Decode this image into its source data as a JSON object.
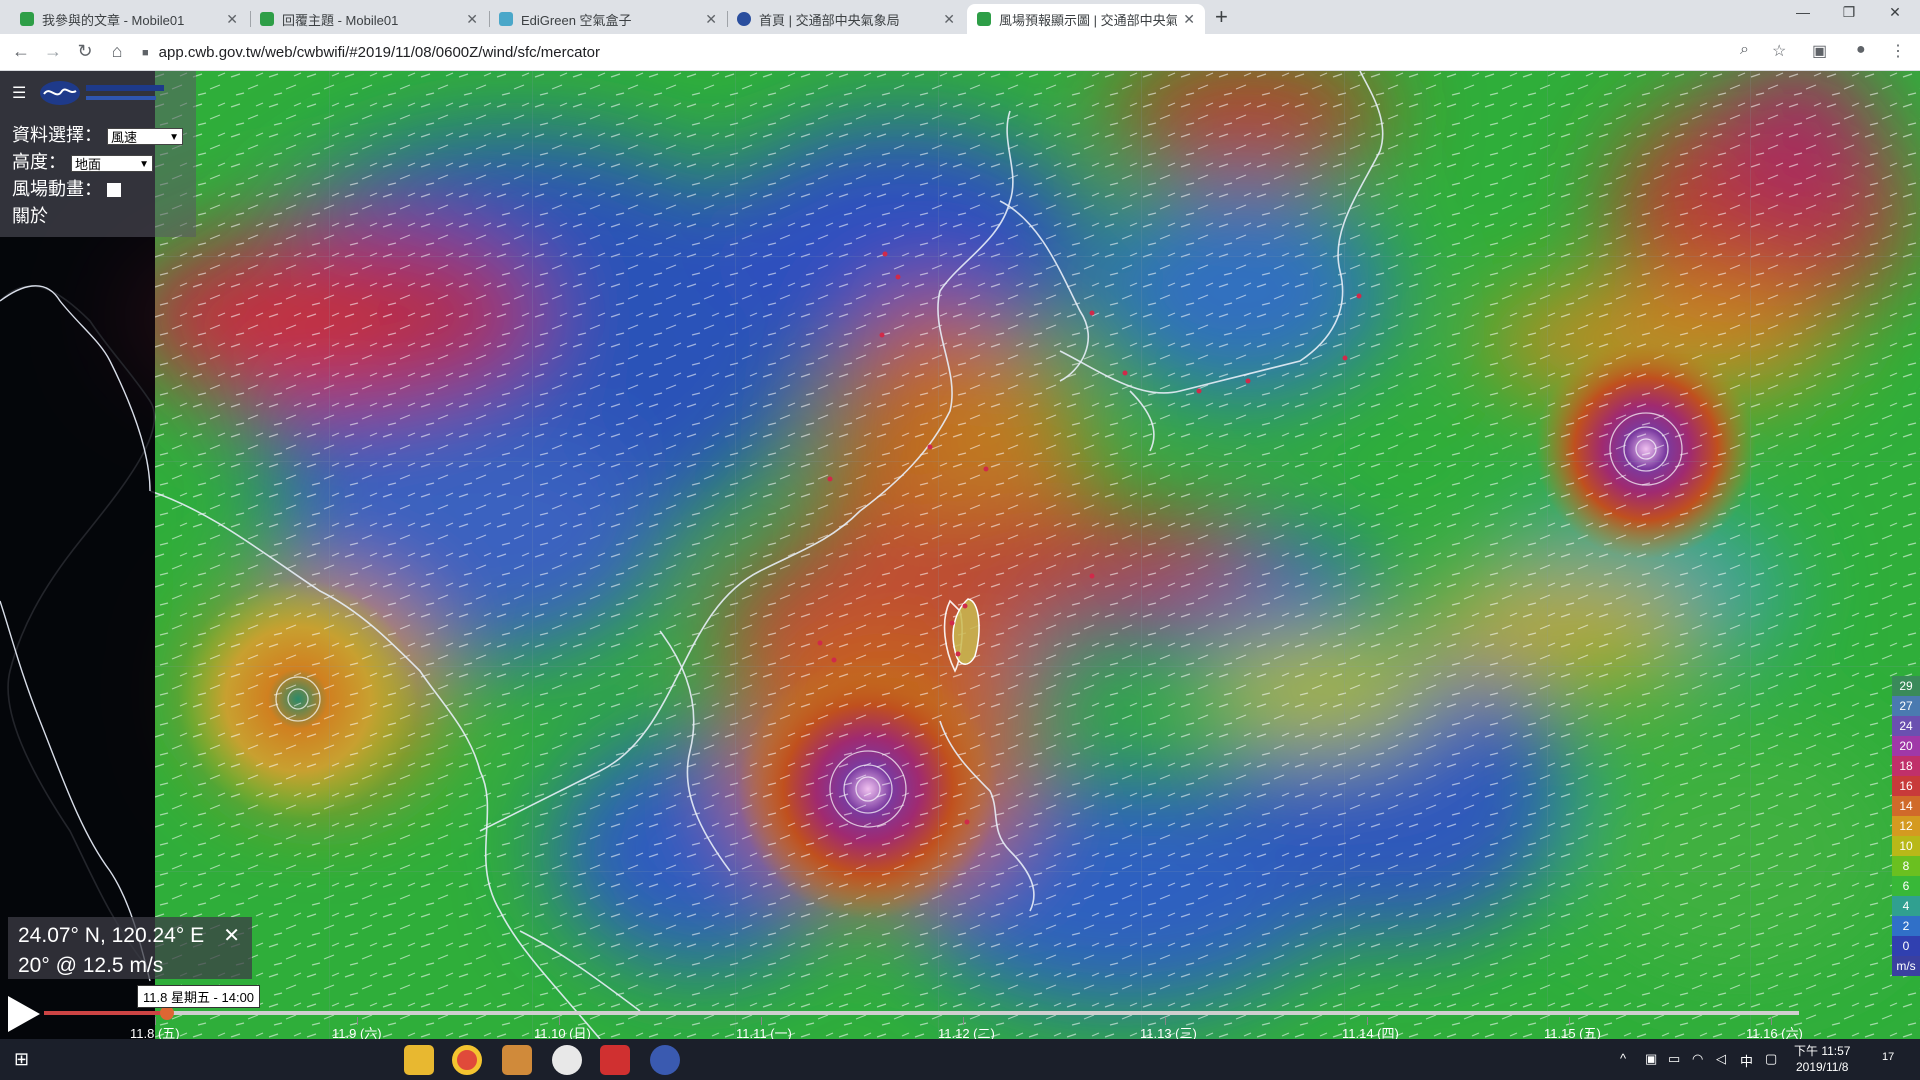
{
  "browser": {
    "tabs": [
      {
        "title": "我參與的文章 - Mobile01",
        "icon_color": "#2e9e47"
      },
      {
        "title": "回覆主題 - Mobile01",
        "icon_color": "#2e9e47"
      },
      {
        "title": "EdiGreen 空氣盒子",
        "icon_color": "#4aa7c9"
      },
      {
        "title": "首頁 | 交通部中央氣象局",
        "icon_color": "#2a4e9e"
      },
      {
        "title": "風場預報顯示圖 | 交通部中央氣象",
        "icon_color": "#2e9e47"
      }
    ],
    "active_tab": 4,
    "url": "app.cwb.gov.tw/web/cwbwifi/#2019/11/08/0600Z/wind/sfc/mercator"
  },
  "panel": {
    "data_label": "資料選擇：",
    "data_value": "風速",
    "height_label": "高度：",
    "height_value": "地面",
    "anim_label": "風場動畫：",
    "about_label": "關於"
  },
  "readout": {
    "coords": "24.07° N, 120.24° E",
    "wind": "20° @ 12.5 m/s"
  },
  "timeline": {
    "current": "11.8 星期五 - 14:00",
    "days": [
      "11.8 (五)",
      "11.9 (六)",
      "11.10 (日)",
      "11.11 (一)",
      "11.12 (二)",
      "11.13 (三)",
      "11.14 (四)",
      "11.15 (五)",
      "11.16 (六)"
    ],
    "progress": 0.07
  },
  "legend": {
    "values": [
      "29",
      "27",
      "24",
      "20",
      "18",
      "16",
      "14",
      "12",
      "10",
      "8",
      "6",
      "4",
      "2",
      "0"
    ],
    "colors": [
      "#3a8a5a",
      "#4a7ab0",
      "#6a50b0",
      "#a038a8",
      "#c0306a",
      "#c83a3a",
      "#d06a2a",
      "#d49a20",
      "#b8b818",
      "#6ac020",
      "#38b838",
      "#30a090",
      "#3070c8",
      "#3040b0"
    ],
    "unit": "m/s"
  },
  "taskbar": {
    "time": "下午 11:57",
    "date": "2019/11/8",
    "ime": "中",
    "notifications": "17"
  }
}
